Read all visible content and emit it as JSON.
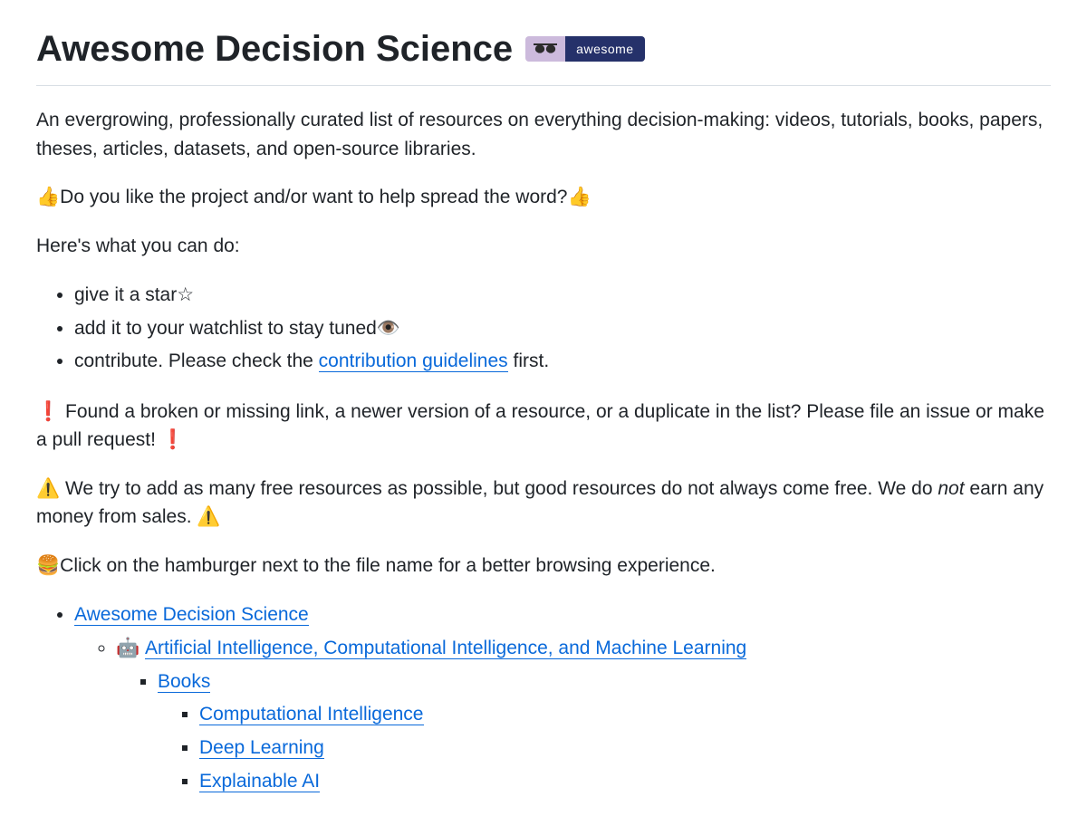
{
  "title": "Awesome Decision Science",
  "badge": {
    "label": "awesome"
  },
  "intro": "An evergrowing, professionally curated list of resources on everything decision-making: videos, tutorials, books, papers, theses, articles, datasets, and open-source libraries.",
  "like_prompt": "Do you like the project and/or want to help spread the word?",
  "heres_what": "Here's what you can do:",
  "actions": {
    "star": "give it a star☆",
    "watch": "add it to your watchlist to stay tuned👁️",
    "contribute_prefix": "contribute. Please check the ",
    "contribute_link": "contribution guidelines",
    "contribute_suffix": " first."
  },
  "broken_link_notice": " Found a broken or missing link, a newer version of a resource, or a duplicate in the list? Please file an issue or make a pull request! ",
  "free_notice_pre": " We try to add as many free resources as possible, but good resources do not always come free. We do ",
  "free_notice_em": "not",
  "free_notice_post": " earn any money from sales. ",
  "hamburger_tip": "Click on the hamburger next to the file name for a better browsing experience.",
  "toc": {
    "root": "Awesome Decision Science",
    "ai_emoji": "🤖",
    "ai": "Artificial Intelligence, Computational Intelligence, and Machine Learning",
    "books": "Books",
    "comp_int": "Computational Intelligence",
    "deep": "Deep Learning",
    "xai": "Explainable AI"
  },
  "emoji": {
    "thumbs_up": "👍",
    "exclaim": "❗",
    "warn": "⚠️",
    "burger": "🍔"
  }
}
